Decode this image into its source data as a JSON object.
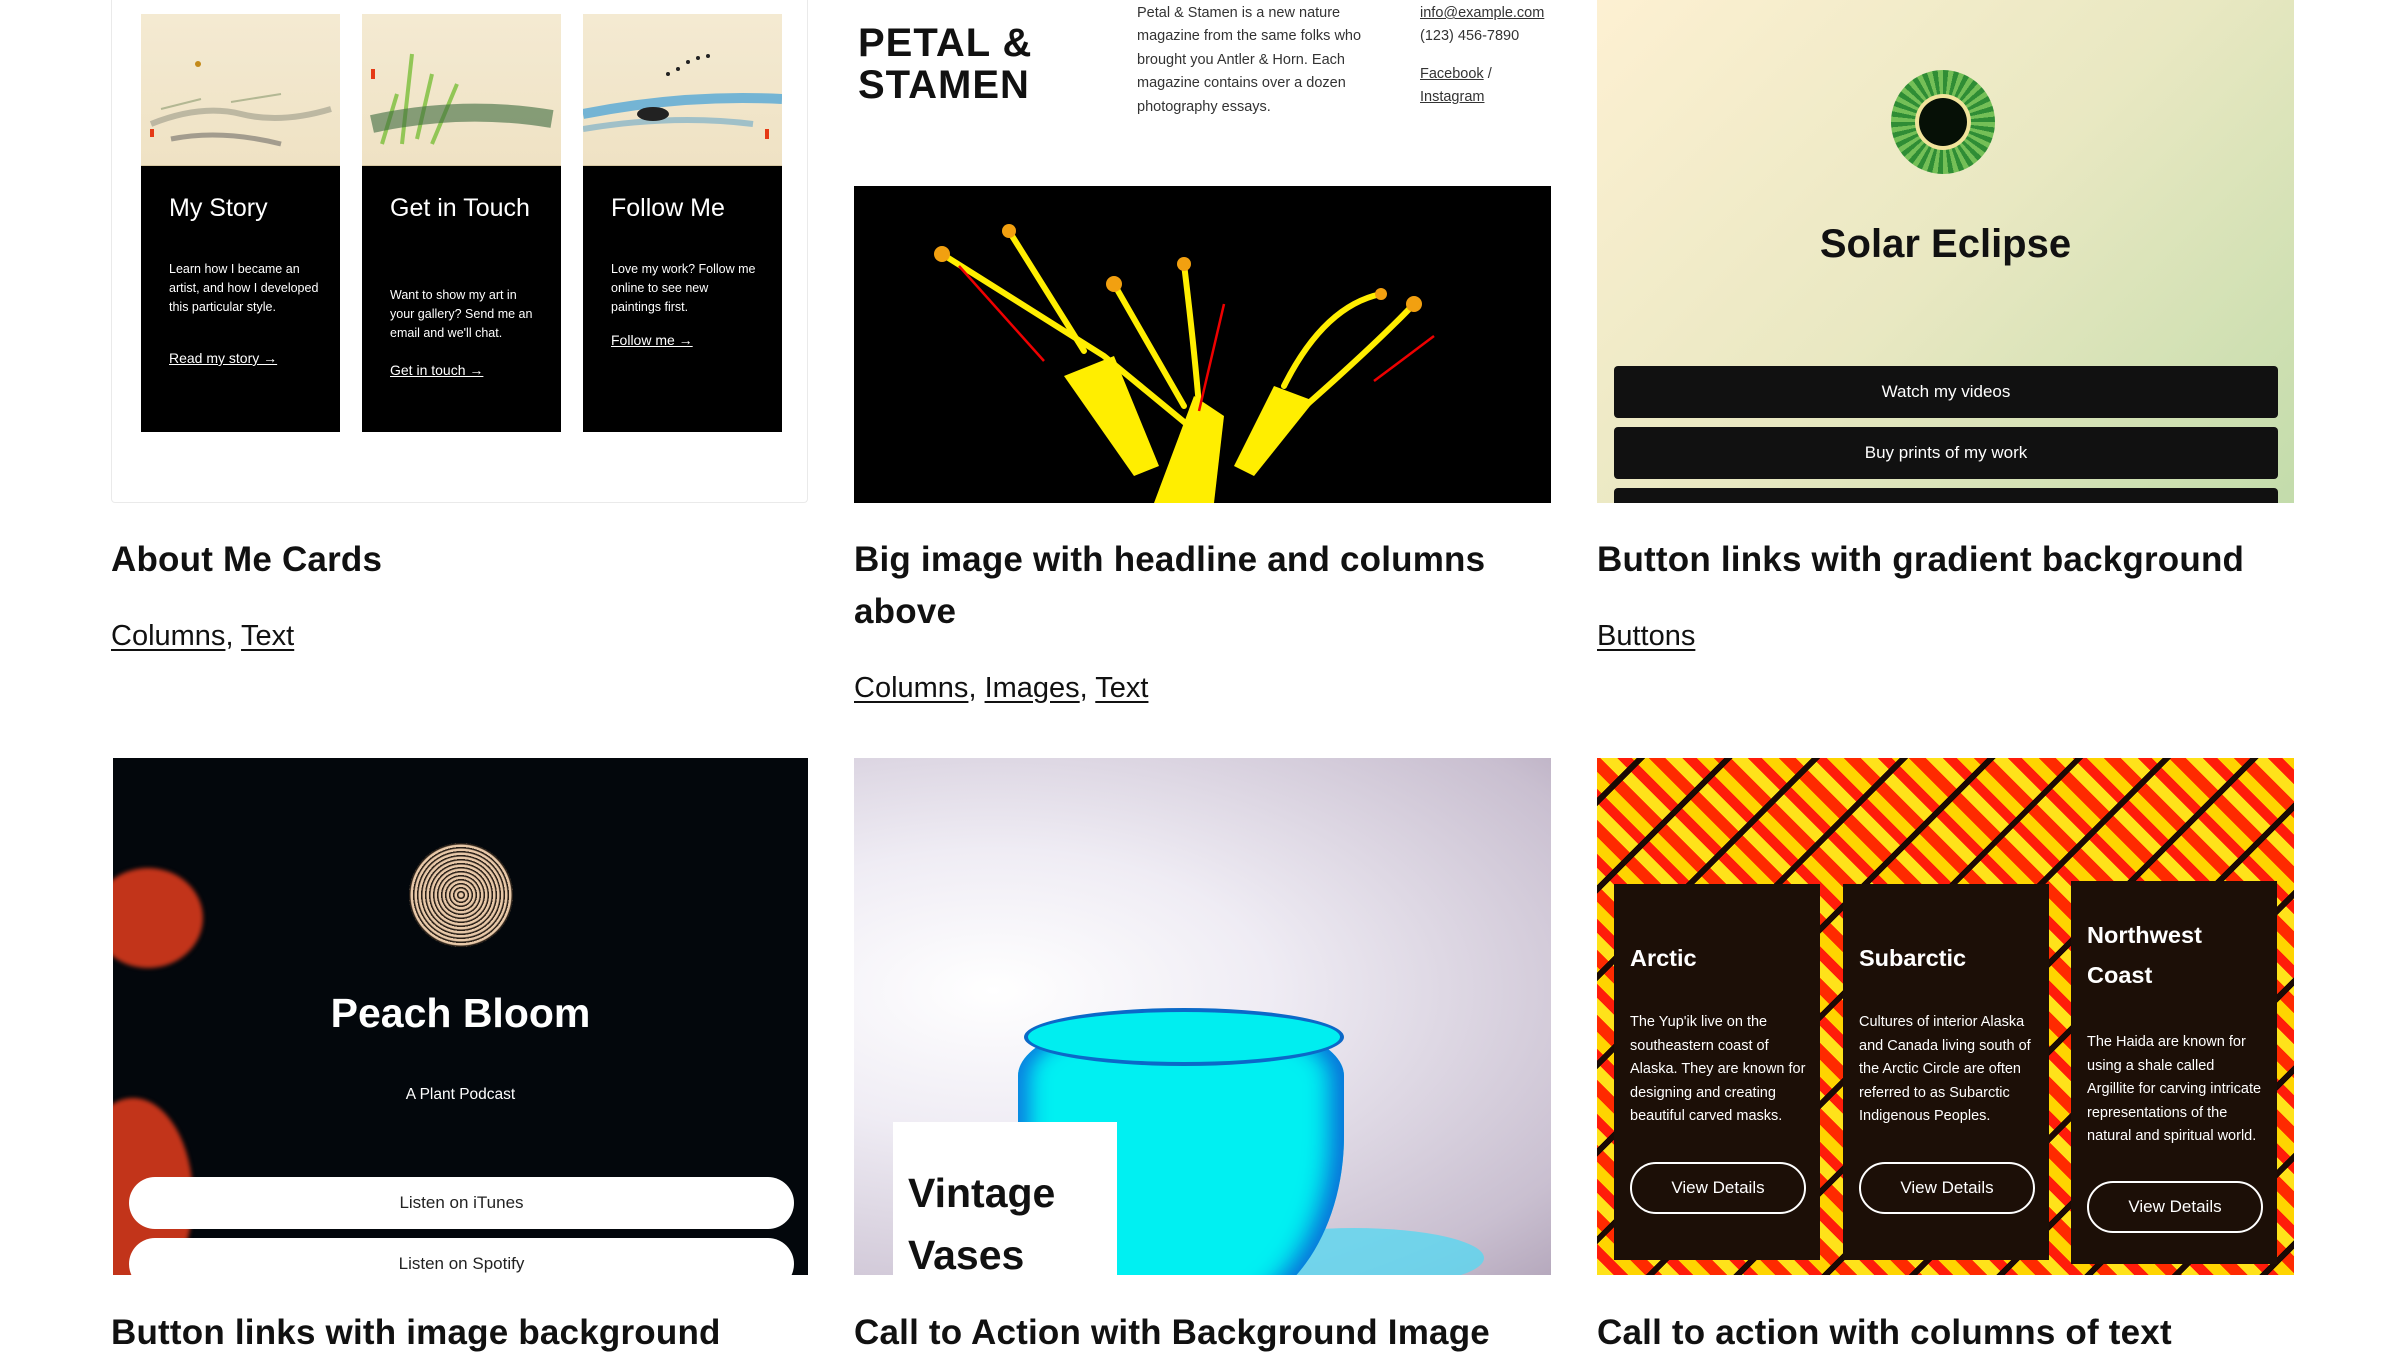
{
  "patterns": [
    {
      "title": "About Me Cards",
      "tags": [
        "Columns",
        "Text"
      ],
      "preview": {
        "cards": [
          {
            "heading": "My Story",
            "body": "Learn how I became an artist, and how I developed this particular style.",
            "link": "Read my story →"
          },
          {
            "heading": "Get in Touch",
            "body": "Want to show my art in your gallery? Send me an email and we'll chat.",
            "link": "Get in touch →"
          },
          {
            "heading": "Follow Me",
            "body": "Love my work? Follow me online to see new paintings first.",
            "link": "Follow me →"
          }
        ]
      }
    },
    {
      "title": "Big image with headline and columns above",
      "tags": [
        "Columns",
        "Images",
        "Text"
      ],
      "preview": {
        "headline": "PETAL & STAMEN",
        "about": "Petal & Stamen is a new nature magazine from the same folks who brought you Antler & Horn. Each magazine contains over a dozen photography essays.",
        "email": "info@example.com",
        "phone": "(123) 456-7890",
        "social_facebook": "Facebook",
        "social_separator": " / ",
        "social_instagram": "Instagram"
      }
    },
    {
      "title": "Button links with gradient background",
      "tags": [
        "Buttons"
      ],
      "preview": {
        "heading": "Solar Eclipse",
        "buttons": [
          "Watch my videos",
          "Buy prints of my work"
        ]
      }
    },
    {
      "title": "Button links with image background",
      "tags": [],
      "preview": {
        "heading": "Peach Bloom",
        "subheading": "A Plant Podcast",
        "buttons": [
          "Listen on iTunes",
          "Listen on Spotify"
        ]
      }
    },
    {
      "title": "Call to Action with Background Image",
      "tags": [],
      "preview": {
        "heading": "Vintage Vases"
      }
    },
    {
      "title": "Call to action with columns of text",
      "tags": [],
      "preview": {
        "columns": [
          {
            "heading": "Arctic",
            "body": "The Yup'ik live on the southeastern coast of Alaska. They are known for designing and creating beautiful carved masks.",
            "button": "View Details"
          },
          {
            "heading": "Subarctic",
            "body": "Cultures of interior Alaska and Canada living south of the Arctic Circle are often referred to as Subarctic Indigenous Peoples.",
            "button": "View Details"
          },
          {
            "heading": "Northwest Coast",
            "body": "The Haida are known for using a shale called Argillite for carving intricate representations of the natural and spiritual world.",
            "button": "View Details"
          }
        ]
      }
    }
  ],
  "separators": {
    "comma": ", "
  }
}
